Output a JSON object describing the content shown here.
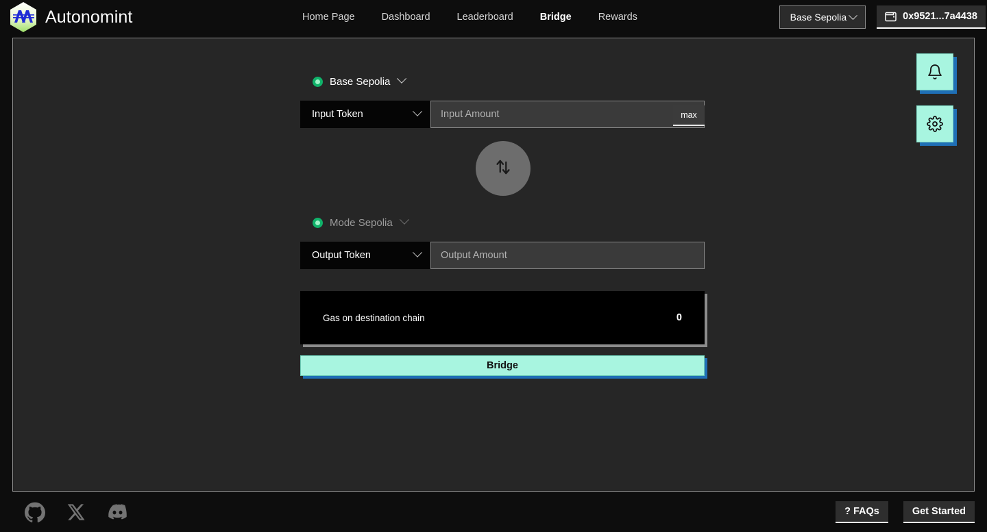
{
  "header": {
    "brand_name": "Autonomint",
    "logo_icon": "autonomint-hex-logo",
    "nav": [
      {
        "label": "Home Page",
        "active": false
      },
      {
        "label": "Dashboard",
        "active": false
      },
      {
        "label": "Leaderboard",
        "active": false
      },
      {
        "label": "Bridge",
        "active": true
      },
      {
        "label": "Rewards",
        "active": false
      }
    ],
    "network_selector": {
      "label": "Base Sepolia",
      "icon": "chevron-down-icon"
    },
    "wallet": {
      "address": "0x9521...7a4438",
      "icon": "wallet-icon"
    }
  },
  "side_buttons": [
    {
      "name": "notifications",
      "icon": "bell-icon"
    },
    {
      "name": "settings",
      "icon": "gear-icon"
    }
  ],
  "bridge": {
    "source": {
      "chain_label": "Base Sepolia",
      "chain_chevron": "chevron-down-icon",
      "token_label": "Input Token",
      "token_chevron": "chevron-down-icon",
      "amount_value": "",
      "amount_placeholder": "Input Amount",
      "max_label": "max"
    },
    "swap": {
      "icon": "swap-vertical-arrows-icon"
    },
    "destination": {
      "chain_label": "Mode Sepolia",
      "chain_chevron": "chevron-down-icon",
      "token_label": "Output Token",
      "token_chevron": "chevron-down-icon",
      "amount_value": "",
      "amount_placeholder": "Output Amount"
    },
    "gas": {
      "label": "Gas on destination chain",
      "value": "0"
    },
    "submit_label": "Bridge"
  },
  "footer": {
    "socials": [
      {
        "name": "github",
        "icon": "github-icon"
      },
      {
        "name": "x-twitter",
        "icon": "x-twitter-icon"
      },
      {
        "name": "discord",
        "icon": "discord-icon"
      }
    ],
    "faqs_label": "? FAQs",
    "get_started_label": "Get Started"
  },
  "colors": {
    "accent_mint": "#a8f5e0",
    "accent_blue_shadow": "#1f6fb5",
    "status_green": "#10b26a",
    "page_bg": "#0d0d0d",
    "panel_bg": "#262626"
  }
}
